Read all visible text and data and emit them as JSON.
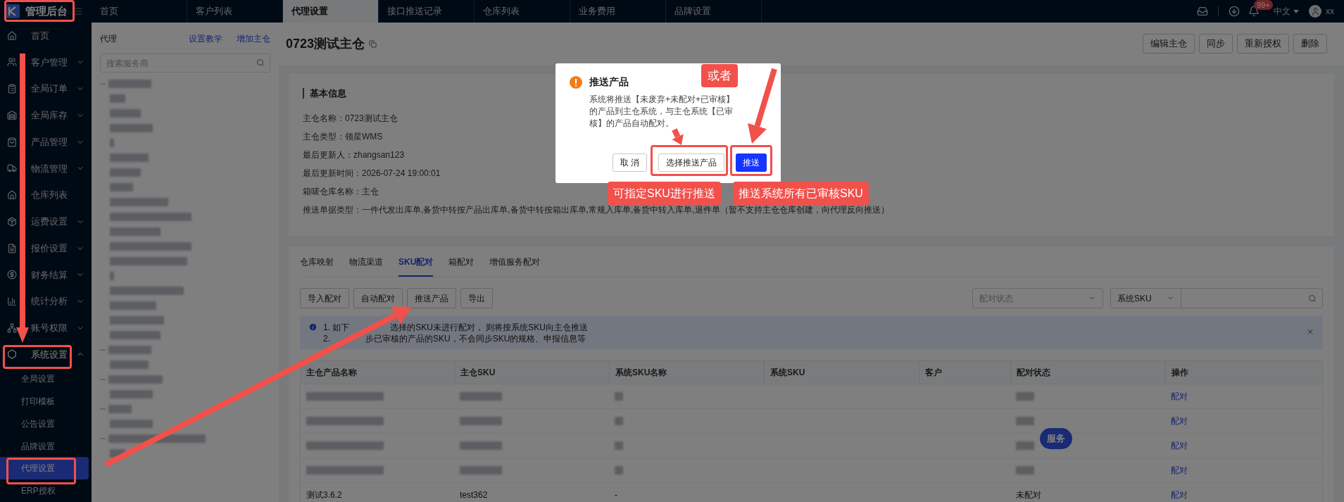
{
  "app": {
    "title": "管理后台"
  },
  "sidebar": {
    "items": [
      {
        "label": "首页",
        "kind": "link",
        "expanded": false
      },
      {
        "label": "客户管理",
        "kind": "group",
        "expanded": false
      },
      {
        "label": "全局订单",
        "kind": "group",
        "expanded": false
      },
      {
        "label": "全局库存",
        "kind": "group",
        "expanded": false
      },
      {
        "label": "产品管理",
        "kind": "group",
        "expanded": false
      },
      {
        "label": "物流管理",
        "kind": "group",
        "expanded": false
      },
      {
        "label": "仓库列表",
        "kind": "link",
        "expanded": false
      },
      {
        "label": "运费设置",
        "kind": "group",
        "expanded": false
      },
      {
        "label": "报价设置",
        "kind": "group",
        "expanded": false
      },
      {
        "label": "财务结算",
        "kind": "group",
        "expanded": false
      },
      {
        "label": "统计分析",
        "kind": "group",
        "expanded": false
      },
      {
        "label": "账号权限",
        "kind": "group",
        "expanded": false
      },
      {
        "label": "系统设置",
        "kind": "group",
        "expanded": true,
        "children": [
          {
            "label": "全局设置",
            "selected": false
          },
          {
            "label": "打印模板",
            "selected": false
          },
          {
            "label": "公告设置",
            "selected": false
          },
          {
            "label": "品牌设置",
            "selected": false
          },
          {
            "label": "代理设置",
            "selected": true
          },
          {
            "label": "ERP授权",
            "selected": false
          }
        ]
      }
    ]
  },
  "top_tabs": [
    {
      "label": "首页",
      "selected": false
    },
    {
      "label": "客户列表",
      "selected": false
    },
    {
      "label": "代理设置",
      "selected": true
    },
    {
      "label": "接口推送记录",
      "selected": false
    },
    {
      "label": "仓库列表",
      "selected": false
    },
    {
      "label": "业务费用",
      "selected": false
    },
    {
      "label": "品牌设置",
      "selected": false
    }
  ],
  "header": {
    "notification_badge": "99+",
    "language": "中文",
    "user": "xx"
  },
  "agent_panel": {
    "title": "代理",
    "links": [
      "设置教学",
      "增加主仓"
    ],
    "search": {
      "placeholder": "搜索服务商"
    }
  },
  "warehouse": {
    "title": "0723测试主仓",
    "actions": [
      "编辑主仓",
      "同步",
      "重新授权",
      "删除"
    ],
    "section_title": "基本信息",
    "fields": [
      {
        "label": "主仓名称：",
        "value": "0723测试主仓"
      },
      {
        "label": "主仓类型：",
        "value": "领星WMS"
      },
      {
        "label": "最后更新人：",
        "value": "zhangsan123"
      },
      {
        "label": "最后更新时间：",
        "value": "2026-07-24 19:00:01"
      },
      {
        "label": "箱唛仓库名称：",
        "value": "主仓"
      },
      {
        "label": "推送单据类型：",
        "value": "一件代发出库单,备货中转按产品出库单,备货中转按箱出库单,常规入库单,备货中转入库单,退件单（暂不支持主仓仓库创建，向代理反向推送）"
      }
    ]
  },
  "tabs": [
    {
      "label": "仓库映射",
      "selected": false
    },
    {
      "label": "物流渠道",
      "selected": false
    },
    {
      "label": "SKU配对",
      "selected": true
    },
    {
      "label": "箱配对",
      "selected": false
    },
    {
      "label": "增值服务配对",
      "selected": false
    }
  ],
  "toolbar": {
    "buttons": [
      "导入配对",
      "自动配对",
      "推送产品",
      "导出"
    ],
    "status_filter": {
      "placeholder": "配对状态"
    },
    "search_type": "系统SKU"
  },
  "notice": {
    "lines": [
      [
        "1. 如下",
        "选择的SKU未进行配对， 则将按系统SKU向主仓推送"
      ],
      [
        "2.",
        "步已审核的产品的SKU，不会同步SKU的规格、申报信息等"
      ]
    ]
  },
  "table": {
    "columns": [
      "主仓产品名称",
      "主仓SKU",
      "系统SKU名称",
      "系统SKU",
      "客户",
      "配对状态",
      "操作"
    ],
    "rows": [
      {
        "kind": "blurred",
        "action": "配对"
      },
      {
        "kind": "blurred",
        "action": "配对"
      },
      {
        "kind": "blurred",
        "action": "配对"
      },
      {
        "kind": "blurred",
        "action": "配对"
      },
      {
        "kind": "text",
        "cells": [
          "测试3.6.2",
          "test362",
          "-",
          null,
          null,
          "未配对"
        ],
        "action": "配对"
      }
    ]
  },
  "float_button": "服务",
  "dialog": {
    "title": "推送产品",
    "message": "系统将推送【未废弃+未配对+已审核】的产品到主仓系统，与主仓系统【已审核】的产品自动配对。",
    "buttons": [
      {
        "label": "取 消",
        "kind": "default"
      },
      {
        "label": "选择推送产品",
        "kind": "default"
      },
      {
        "label": "推送",
        "kind": "primary"
      }
    ]
  },
  "annotations": [
    "或者",
    "可指定SKU进行推送",
    "推送系统所有已审核SKU"
  ]
}
